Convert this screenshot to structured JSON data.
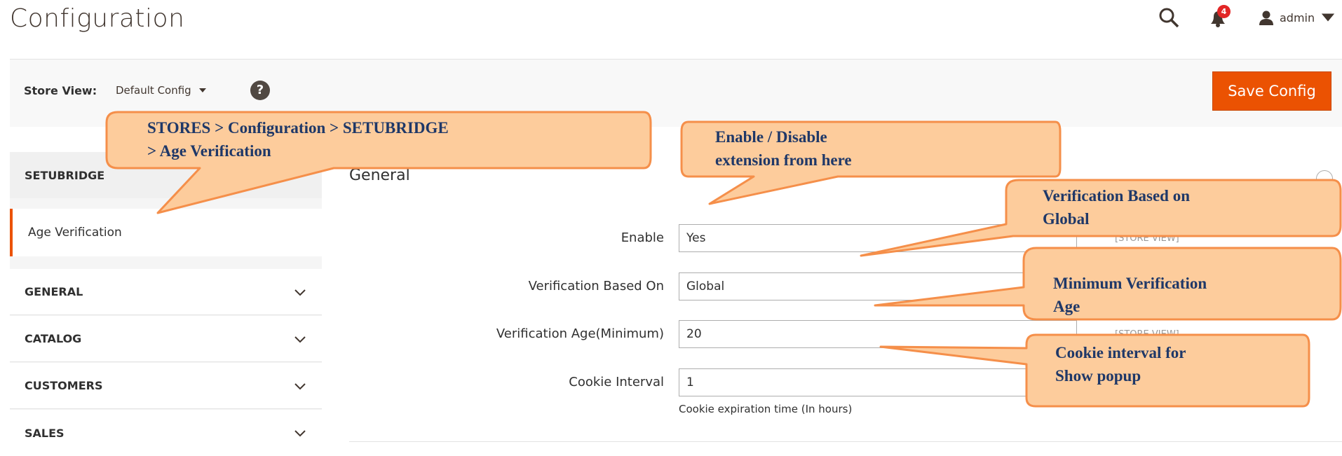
{
  "header": {
    "title": "Configuration",
    "notification_count": "4",
    "user_name": "admin",
    "icons": [
      "search-icon",
      "bell-icon",
      "user-icon",
      "caret-down-icon"
    ]
  },
  "store_bar": {
    "label": "Store View:",
    "selected": "Default Config",
    "help": "?",
    "save_label": "Save Config"
  },
  "sidebar": {
    "setubridge": "SETUBRIDGE",
    "age_verification": "Age Verification",
    "tabs": [
      "GENERAL",
      "CATALOG",
      "CUSTOMERS",
      "SALES"
    ]
  },
  "form": {
    "section_title": "General",
    "rows": [
      {
        "label": "Enable",
        "value": "Yes",
        "scope": "[STORE VIEW]"
      },
      {
        "label": "Verification Based On",
        "value": "Global",
        "scope": ""
      },
      {
        "label": "Verification Age(Minimum)",
        "value": "20",
        "scope": "[STORE VIEW]"
      },
      {
        "label": "Cookie Interval",
        "value": "1",
        "scope": ""
      }
    ],
    "cookie_note": "Cookie expiration time (In hours)"
  },
  "callouts": {
    "path": [
      "STORES > Configuration >  SETUBRIDGE",
      "> Age Verification"
    ],
    "enable": [
      "Enable / Disable",
      "extension from here"
    ],
    "based_on": [
      "Verification Based on",
      "Global"
    ],
    "min_age": [
      "Minimum  Verification",
      "Age"
    ],
    "cookie": [
      "Cookie interval  for",
      "Show popup"
    ]
  },
  "colors": {
    "accent": "#eb5202",
    "callout_fill": "#fdcc9c",
    "callout_stroke": "#f58f4a",
    "callout_text": "#1f3868"
  }
}
